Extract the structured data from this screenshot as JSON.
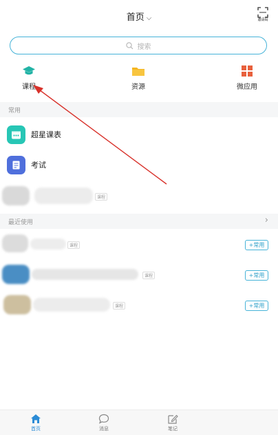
{
  "header": {
    "title": "首页",
    "scan_label": "邀请码"
  },
  "search": {
    "placeholder": "搜索"
  },
  "quick": [
    {
      "label": "课程",
      "icon": "graduation-cap-icon",
      "color": "#22b3a6"
    },
    {
      "label": "资源",
      "icon": "folder-icon",
      "color": "#f5b621"
    },
    {
      "label": "微应用",
      "icon": "grid-apps-icon",
      "color": "#e8613d"
    }
  ],
  "sections": {
    "common": "常用",
    "recent": "最近使用"
  },
  "apps": [
    {
      "label": "超星课表",
      "icon": "calendar-icon",
      "color": "#27c6b5"
    },
    {
      "label": "考试",
      "icon": "exam-paper-icon",
      "color": "#4f6fdc"
    }
  ],
  "common_blurred": {
    "tag": "课程"
  },
  "recent": [
    {
      "tag": "课程",
      "add_label": "+常用"
    },
    {
      "tag": "课程",
      "add_label": "+常用"
    },
    {
      "tag": "课程",
      "add_label": "+常用"
    }
  ],
  "tabs": [
    {
      "label": "首页",
      "icon": "home-icon",
      "active": true
    },
    {
      "label": "消息",
      "icon": "chat-bubble-icon",
      "active": false
    },
    {
      "label": "笔记",
      "icon": "note-edit-icon",
      "active": false
    }
  ],
  "colors": {
    "accent": "#46b3d8",
    "tab_active": "#2a8bd6",
    "annotation_arrow": "#d8322b"
  }
}
